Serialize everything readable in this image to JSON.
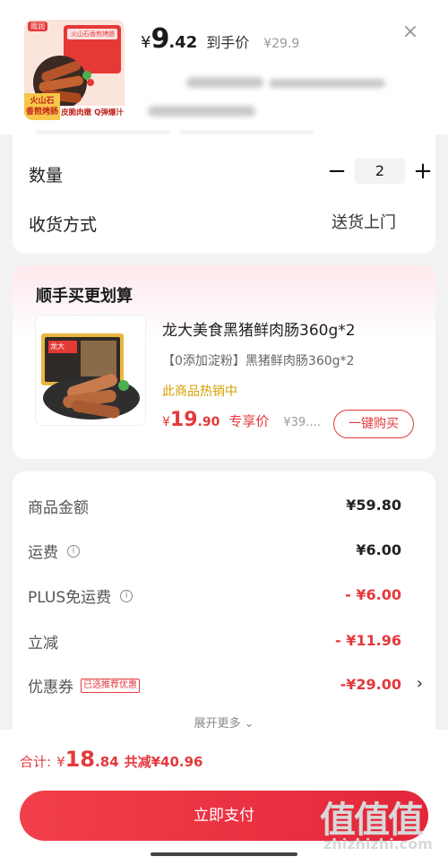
{
  "product": {
    "thumb": {
      "brand_tag": "雨润",
      "package_text": "火山石香煎烤肠",
      "corner_label": "火山石\n香煎烤肠",
      "bottom_label": "皮脆肉嫩 Q弹爆汁"
    },
    "price": {
      "currency": "¥",
      "integer": "9",
      "decimal": ".42",
      "label": "到手价",
      "original": "¥29.9"
    }
  },
  "quantity": {
    "label": "数量",
    "minus": "−",
    "value": "2",
    "plus": "+"
  },
  "shipping": {
    "label": "收货方式",
    "value": "送货上门"
  },
  "upsell": {
    "title": "顺手买更划算",
    "name": "龙大美食黑猪鲜肉肠360g*2",
    "subtitle": "【0添加淀粉】黑猪鲜肉肠360g*2",
    "hot": "此商品热销中",
    "price": {
      "currency": "¥",
      "integer": "19",
      "decimal": ".90",
      "label": "专享价",
      "original": "¥39...."
    },
    "buy_label": "一键购买",
    "image_tag": "龙大"
  },
  "summary": {
    "rows": [
      {
        "label": "商品金额",
        "value": "¥59.80"
      },
      {
        "label": "运费",
        "value": "¥6.00"
      },
      {
        "label": "PLUS免运费",
        "value": "- ¥6.00"
      },
      {
        "label": "立减",
        "value": "- ¥11.96"
      },
      {
        "label": "优惠券",
        "tag": "已选推荐优惠",
        "value": "-¥29.00",
        "chevron": "›"
      }
    ],
    "expand": "展开更多 ⌄"
  },
  "footer": {
    "total_label": "合计:",
    "currency": "¥",
    "total_integer": "18",
    "total_decimal": ".84",
    "saved": "共减¥40.96",
    "pay_label": "立即支付"
  },
  "watermark": {
    "chars": "值值值",
    "url": "zhizhizhi.com"
  },
  "colors": {
    "accent": "#e4393c",
    "hot": "#d4a000",
    "background": "#f2f2f2"
  },
  "icons": {
    "close": "close-icon",
    "info": "info-icon",
    "chevron": "chevron-right-icon"
  }
}
